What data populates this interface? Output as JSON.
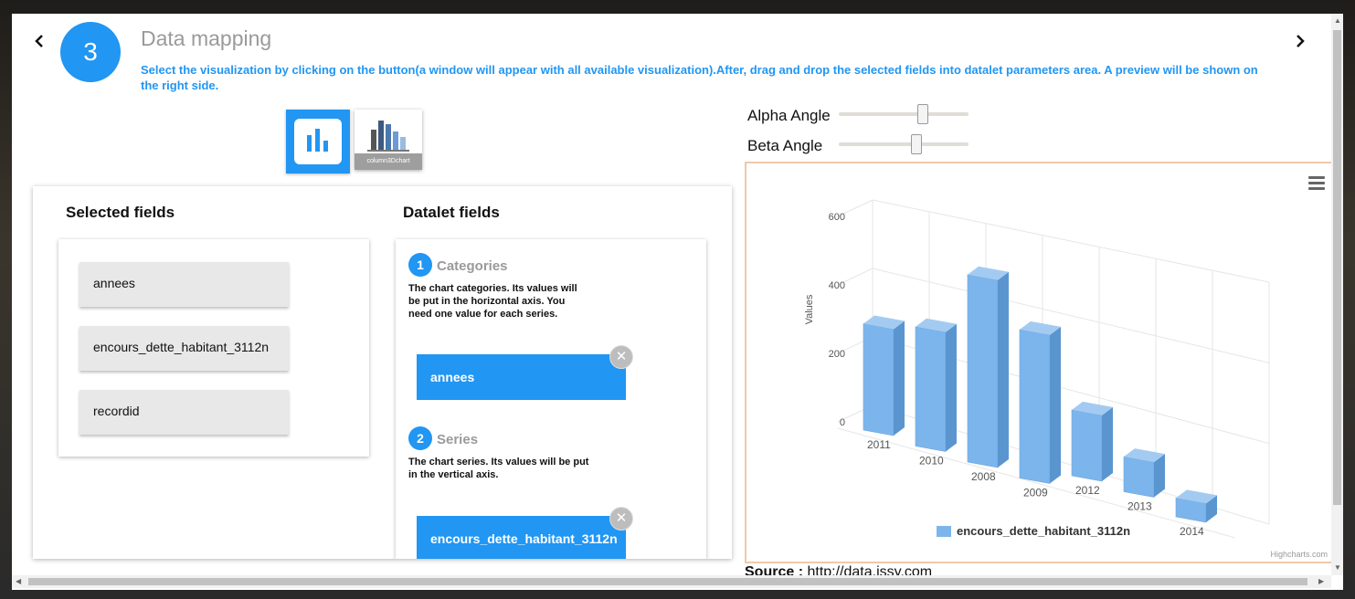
{
  "header": {
    "step_number": "3",
    "title": "Data mapping",
    "description": "Select the visualization by clicking on the button(a window will appear with all available visualization).After, drag and drop the selected fields into datalet parameters area. A preview will be shown on the right side."
  },
  "visualization": {
    "thumbnail_label": "column3Dchart"
  },
  "selected_fields": {
    "title": "Selected fields",
    "items": [
      "annees",
      "encours_dette_habitant_3112n",
      "recordid"
    ]
  },
  "datalet_fields": {
    "title": "Datalet fields",
    "params": [
      {
        "number": "1",
        "name": "Categories",
        "description": "The chart categories. Its values will be put in the horizontal axis. You need one value for each series.",
        "value": "annees"
      },
      {
        "number": "2",
        "name": "Series",
        "description": "The chart series. Its values will be put in the vertical axis.",
        "value": "encours_dette_habitant_3112n"
      }
    ],
    "remove_symbol": "✕"
  },
  "sliders": {
    "alpha_label": "Alpha Angle",
    "beta_label": "Beta Angle",
    "alpha_value": 0.65,
    "beta_value": 0.6
  },
  "chart_data": {
    "type": "bar",
    "title": "",
    "xlabel": "",
    "ylabel": "Values",
    "categories": [
      "2011",
      "2010",
      "2008",
      "2009",
      "2012",
      "2013",
      "2014"
    ],
    "series": [
      {
        "name": "encours_dette_habitant_3112n",
        "values": [
          300,
          340,
          550,
          430,
          175,
          80,
          30
        ]
      }
    ],
    "y_ticks": [
      "0",
      "200",
      "400",
      "600"
    ],
    "ylim": [
      0,
      600
    ],
    "credits": "Highcharts.com",
    "bar_color": "#7cb5ec",
    "bar_side_color": "#5a95cf",
    "bar_top_color": "#a3cbf2",
    "grid": true,
    "legend": "bottom-center"
  },
  "source": {
    "label": "Source :",
    "url": "http://data.issy.com"
  },
  "colors": {
    "accent": "#2196f3"
  }
}
